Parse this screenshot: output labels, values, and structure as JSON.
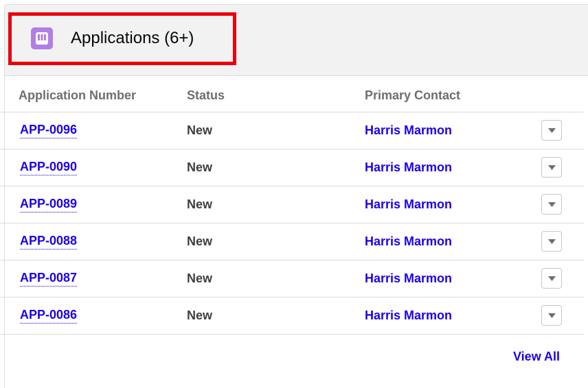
{
  "card": {
    "icon": "applications-icon",
    "title": "Applications (6+)"
  },
  "columns": {
    "number": "Application Number",
    "status": "Status",
    "contact": "Primary Contact"
  },
  "rows": [
    {
      "number": "APP-0096",
      "status": "New",
      "contact": "Harris Marmon"
    },
    {
      "number": "APP-0090",
      "status": "New",
      "contact": "Harris Marmon"
    },
    {
      "number": "APP-0089",
      "status": "New",
      "contact": "Harris Marmon"
    },
    {
      "number": "APP-0088",
      "status": "New",
      "contact": "Harris Marmon"
    },
    {
      "number": "APP-0087",
      "status": "New",
      "contact": "Harris Marmon"
    },
    {
      "number": "APP-0086",
      "status": "New",
      "contact": "Harris Marmon"
    }
  ],
  "row_menu_icon": "chevron-down-icon",
  "footer": {
    "view_all": "View All"
  },
  "colors": {
    "link": "#1b00ea",
    "icon_bg": "#b27ee4",
    "highlight": "#e8000b"
  }
}
